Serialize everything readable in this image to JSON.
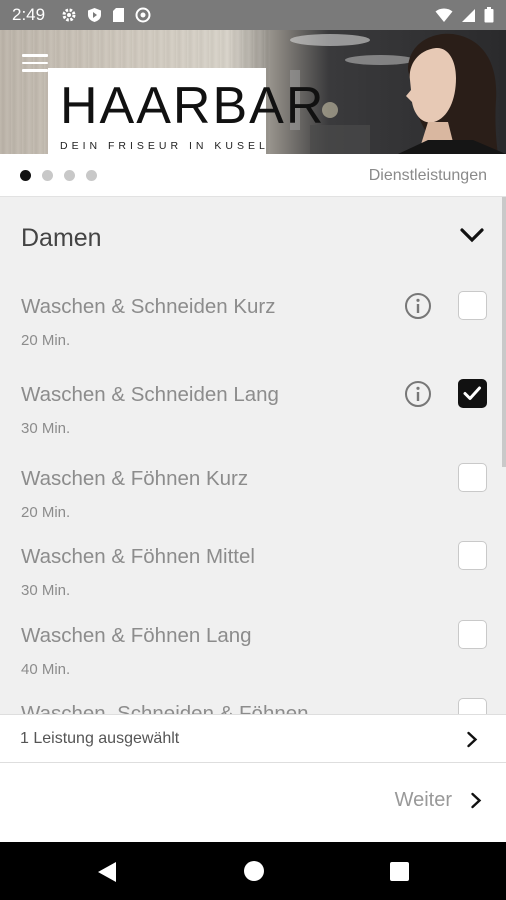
{
  "status_bar": {
    "time": "2:49"
  },
  "hero": {
    "logo_title": "HAARBAR",
    "logo_subtitle": "DEIN FRISEUR IN KUSEL"
  },
  "pager": {
    "label": "Dienstleistungen"
  },
  "section": {
    "title": "Damen"
  },
  "services": [
    {
      "name": "Waschen & Schneiden Kurz",
      "duration": "20 Min.",
      "has_info": true,
      "selected": false
    },
    {
      "name": "Waschen & Schneiden Lang",
      "duration": "30 Min.",
      "has_info": true,
      "selected": true
    },
    {
      "name": "Waschen & Föhnen Kurz",
      "duration": "20 Min.",
      "has_info": false,
      "selected": false
    },
    {
      "name": "Waschen & Föhnen Mittel",
      "duration": "30 Min.",
      "has_info": false,
      "selected": false
    },
    {
      "name": "Waschen & Föhnen Lang",
      "duration": "40 Min.",
      "has_info": false,
      "selected": false
    },
    {
      "name": "Waschen, Schneiden & Föhnen",
      "duration": "",
      "has_info": false,
      "selected": false
    }
  ],
  "selection": {
    "summary": "1 Leistung ausgewählt"
  },
  "footer": {
    "next_label": "Weiter"
  },
  "colors": {
    "status_bar": "#7a7a7a",
    "content_bg": "#f0f0f0",
    "text_muted": "#8c8c8c",
    "check_active": "#111111"
  }
}
